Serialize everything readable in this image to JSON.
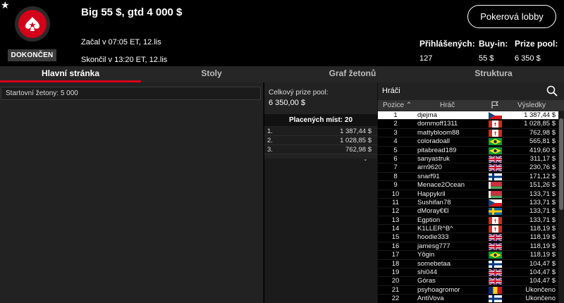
{
  "header": {
    "title": "Big 55 $, gtd 4 000 $",
    "status": "DOKONČEN",
    "started": "Začal v 07:05 ET, 12.lis",
    "ended": "Skončil v 13:20 ET, 12.lis",
    "lobby_button": "Pokerová lobby",
    "registered_label": "Přihlášených:",
    "registered_value": "127",
    "buyin_label": "Buy-in:",
    "buyin_value": "55 $",
    "prizepool_label": "Prize pool:",
    "prizepool_value": "6 350 $"
  },
  "tabs": [
    "Hlavní stránka",
    "Stoly",
    "Graf žetonů",
    "Struktura"
  ],
  "left": {
    "starting_chips": "Startovní žetony:  5 000"
  },
  "middle": {
    "total_prize_label": "Celkový prize pool:",
    "total_prize_value": "6 350,00 $",
    "paid_places": "Placených míst: 20",
    "payouts": [
      {
        "place": "1.",
        "amount": "1 387,44 $"
      },
      {
        "place": "2.",
        "amount": "1 028,85 $"
      },
      {
        "place": "3.",
        "amount": "762,98 $"
      }
    ]
  },
  "players": {
    "title": "Hráči",
    "col_position": "Pozice",
    "col_player": "Hráč",
    "col_results": "Výsledky",
    "rows": [
      {
        "pos": "1",
        "name": "djejma",
        "flag": "cz",
        "result": "1 387,44 $"
      },
      {
        "pos": "2",
        "name": "dommoff1311",
        "flag": "ca",
        "result": "1 028,85 $"
      },
      {
        "pos": "3",
        "name": "mattybloom88",
        "flag": "ca",
        "result": "762,98 $"
      },
      {
        "pos": "4",
        "name": "coloradoall",
        "flag": "br",
        "result": "565,81 $"
      },
      {
        "pos": "5",
        "name": "pitabread189",
        "flag": "br",
        "result": "419,60 $"
      },
      {
        "pos": "6",
        "name": "sanyastruk",
        "flag": "uk",
        "result": "311,17 $"
      },
      {
        "pos": "7",
        "name": "arn9620",
        "flag": "uk",
        "result": "230,76 $"
      },
      {
        "pos": "8",
        "name": "snarf91",
        "flag": "fi",
        "result": "171,12 $"
      },
      {
        "pos": "9",
        "name": "Menace2Ocean",
        "flag": "by",
        "result": "151,26 $"
      },
      {
        "pos": "10",
        "name": "Happykril",
        "flag": "by",
        "result": "133,71 $"
      },
      {
        "pos": "11",
        "name": "Sushifan78",
        "flag": "cz",
        "result": "133,71 $"
      },
      {
        "pos": "12",
        "name": "dMoray€€l",
        "flag": "se",
        "result": "133,71 $"
      },
      {
        "pos": "13",
        "name": "Egption",
        "flag": "ca",
        "result": "133,71 $"
      },
      {
        "pos": "14",
        "name": "K1LLER^B^",
        "flag": "ca",
        "result": "118,19 $"
      },
      {
        "pos": "15",
        "name": "hoodie333",
        "flag": "uk",
        "result": "118,19 $"
      },
      {
        "pos": "16",
        "name": "jamesg777",
        "flag": "uk",
        "result": "118,19 $"
      },
      {
        "pos": "17",
        "name": "Yôgin",
        "flag": "br",
        "result": "118,19 $"
      },
      {
        "pos": "18",
        "name": "somebetaa",
        "flag": "fi",
        "result": "104,47 $"
      },
      {
        "pos": "19",
        "name": "shi044",
        "flag": "uk",
        "result": "104,47 $"
      },
      {
        "pos": "20",
        "name": "Góras",
        "flag": "uk",
        "result": "104,47 $"
      },
      {
        "pos": "21",
        "name": "psyhoagromor",
        "flag": "ro",
        "result": "Ukončeno"
      },
      {
        "pos": "22",
        "name": "AntiVova",
        "flag": "fi",
        "result": "Ukončeno"
      }
    ]
  },
  "colors": {
    "accent": "#d4001a",
    "panel": "#222222",
    "header_bg": "#000000"
  }
}
